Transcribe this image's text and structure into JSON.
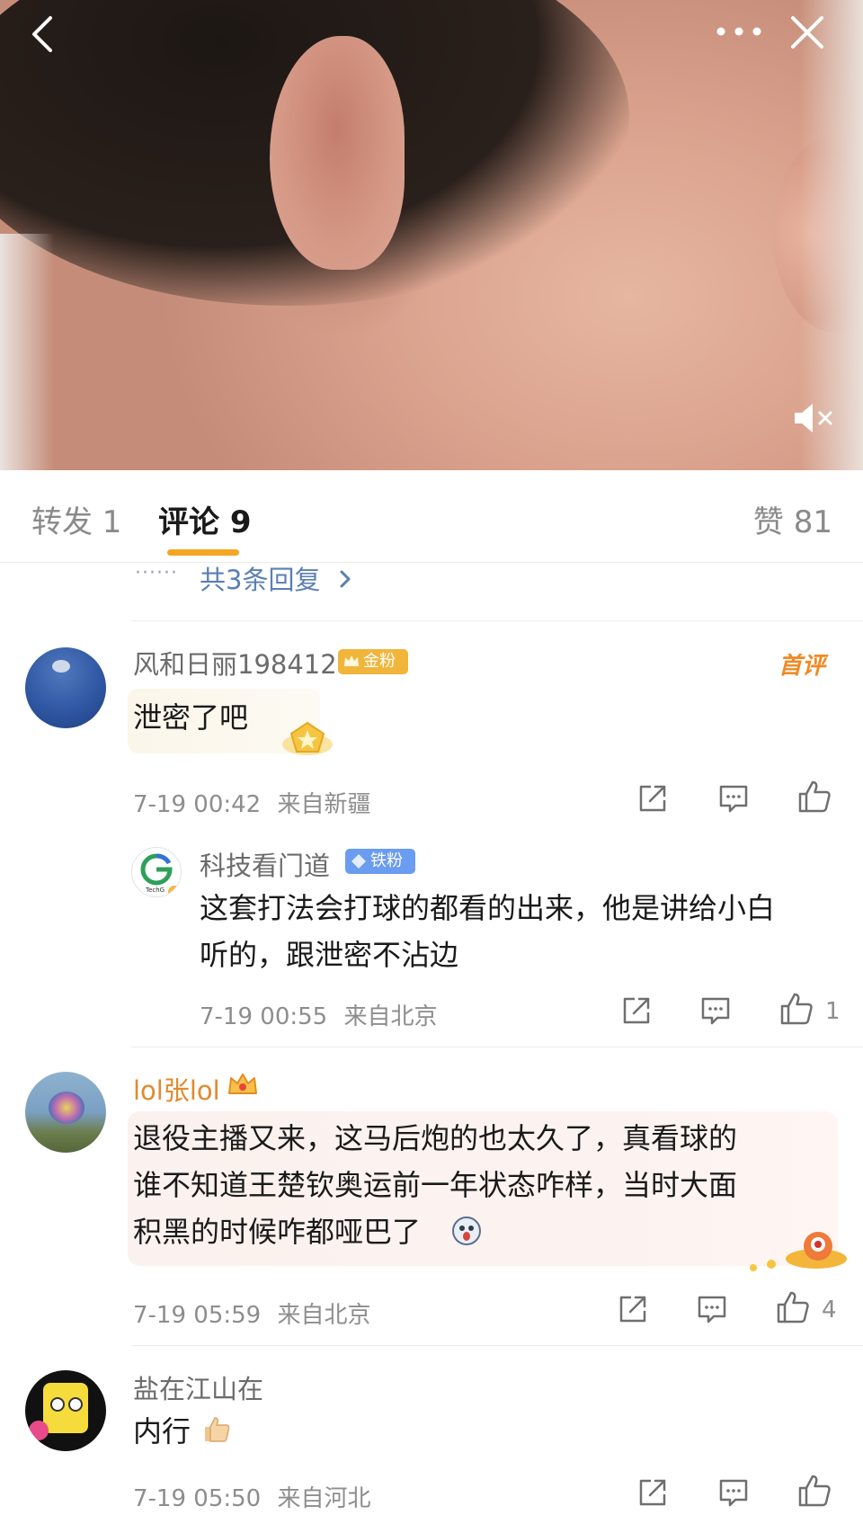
{
  "tabs": {
    "repost": "转发 1",
    "comments": "评论 9",
    "likes": "赞 81"
  },
  "replies_summary": {
    "dots": "······",
    "text": "共3条回复"
  },
  "comments": [
    {
      "username": "风和日丽198412",
      "badge": "金粉2",
      "tag": "首评",
      "text": "泄密了吧",
      "time": "7-19 00:42",
      "location": "来自新疆",
      "like_count": ""
    },
    {
      "username": "科技看门道",
      "badge": "铁粉4",
      "avatar_text": "TechG",
      "text_line1": "这套打法会打球的都看的出来，他是讲给小白",
      "text_line2": "听的，跟泄密不沾边",
      "time": "7-19 00:55",
      "location": "来自北京",
      "like_count": "1"
    },
    {
      "username": "lol张lol",
      "text_line1": "退役主播又来，这马后炮的也太久了，真看球的",
      "text_line2": "谁不知道王楚钦奥运前一年状态咋样，当时大面",
      "text_line3": "积黑的时候咋都哑巴了",
      "time": "7-19 05:59",
      "location": "来自北京",
      "like_count": "4"
    },
    {
      "username": "盐在江山在",
      "text": "内行",
      "time": "7-19 05:50",
      "location": "来自河北",
      "like_count": ""
    }
  ],
  "colors": {
    "accent": "#f5a623",
    "link": "#5a7fb5",
    "iron_badge": "#6a9cf0",
    "gold_badge": "#f0b53a",
    "first_comment": "#f08a24"
  }
}
